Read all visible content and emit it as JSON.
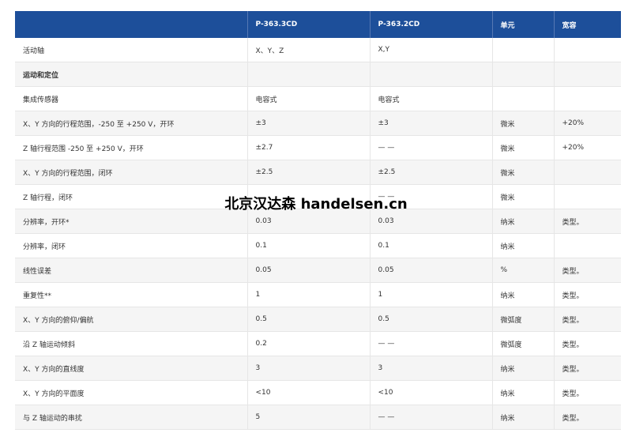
{
  "header": [
    "",
    "P-363.3CD",
    "P-363.2CD",
    "单元",
    "宽容"
  ],
  "rows": [
    {
      "cells": [
        "活动轴",
        "X、Y、Z",
        "X,Y",
        "",
        ""
      ]
    },
    {
      "cells": [
        "运动和定位",
        "",
        "",
        "",
        ""
      ],
      "section": true
    },
    {
      "cells": [
        "集成传感器",
        "电容式",
        "电容式",
        "",
        ""
      ]
    },
    {
      "cells": [
        "X、Y 方向的行程范围，-250 至 +250 V，开环",
        "±3",
        "±3",
        "微米",
        "+20%"
      ]
    },
    {
      "cells": [
        "Z 轴行程范围 -250 至 +250 V，开环",
        "±2.7",
        "— —",
        "微米",
        "+20%"
      ]
    },
    {
      "cells": [
        "X、Y 方向的行程范围，闭环",
        "±2.5",
        "±2.5",
        "微米",
        ""
      ]
    },
    {
      "cells": [
        "Z 轴行程，闭环",
        "",
        "— —",
        "微米",
        ""
      ]
    },
    {
      "cells": [
        "分辨率，开环*",
        "0.03",
        "0.03",
        "纳米",
        "类型。"
      ]
    },
    {
      "cells": [
        "分辨率，闭环",
        "0.1",
        "0.1",
        "纳米",
        ""
      ]
    },
    {
      "cells": [
        "线性误差",
        "0.05",
        "0.05",
        "%",
        "类型。"
      ]
    },
    {
      "cells": [
        "重复性**",
        "1",
        "1",
        "纳米",
        "类型。"
      ]
    },
    {
      "cells": [
        "X、Y 方向的俯仰/偏航",
        "0.5",
        "0.5",
        "微弧度",
        "类型。"
      ]
    },
    {
      "cells": [
        "沿 Z 轴运动倾斜",
        "0.2",
        "— —",
        "微弧度",
        "类型。"
      ]
    },
    {
      "cells": [
        "X、Y 方向的直线度",
        "3",
        "3",
        "纳米",
        "类型。"
      ]
    },
    {
      "cells": [
        "X、Y 方向的平面度",
        "<10",
        "<10",
        "纳米",
        "类型。"
      ]
    },
    {
      "cells": [
        "与 Z 轴运动的串扰",
        "5",
        "— —",
        "纳米",
        "类型。"
      ]
    }
  ],
  "watermark": "北京汉达森 handelsen.cn"
}
